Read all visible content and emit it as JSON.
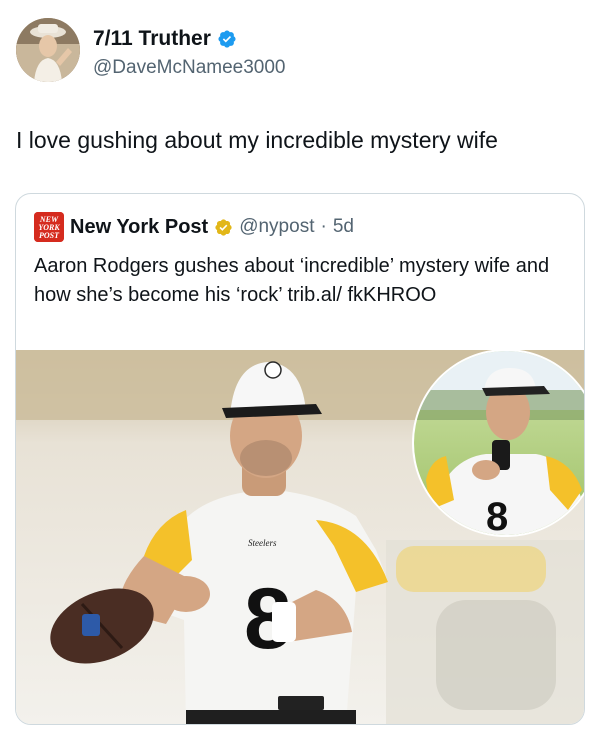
{
  "author": {
    "display_name": "7/11 Truther",
    "handle": "@DaveMcNamee3000",
    "avatar_icon": "profile-photo",
    "verified_icon": "verified-badge-icon"
  },
  "tweet": {
    "text": "I love gushing about my incredible mystery wife"
  },
  "quoted": {
    "logo_icon": "new-york-post-logo",
    "logo_text": [
      "NEW",
      "YORK",
      "POST"
    ],
    "display_name": "New York Post",
    "badge_icon": "gold-verified-badge-icon",
    "handle": "@nypost",
    "separator": "·",
    "time": "5d",
    "text": "Aaron Rodgers gushes about ‘incredible’ mystery wife and how she’s become his ‘rock’ trib.al/ fkKHROO",
    "media": {
      "jersey_team": "Steelers",
      "jersey_number": "8",
      "colors": {
        "jersey": "#f4f4f4",
        "sleeve": "#f7c22b",
        "field": "#cfc3a6"
      }
    }
  },
  "colors": {
    "text": "#0f1419",
    "secondary": "#536471",
    "verified_blue": "#1d9bf0",
    "nyp_red": "#d52b1e",
    "border": "#cfd9de"
  }
}
